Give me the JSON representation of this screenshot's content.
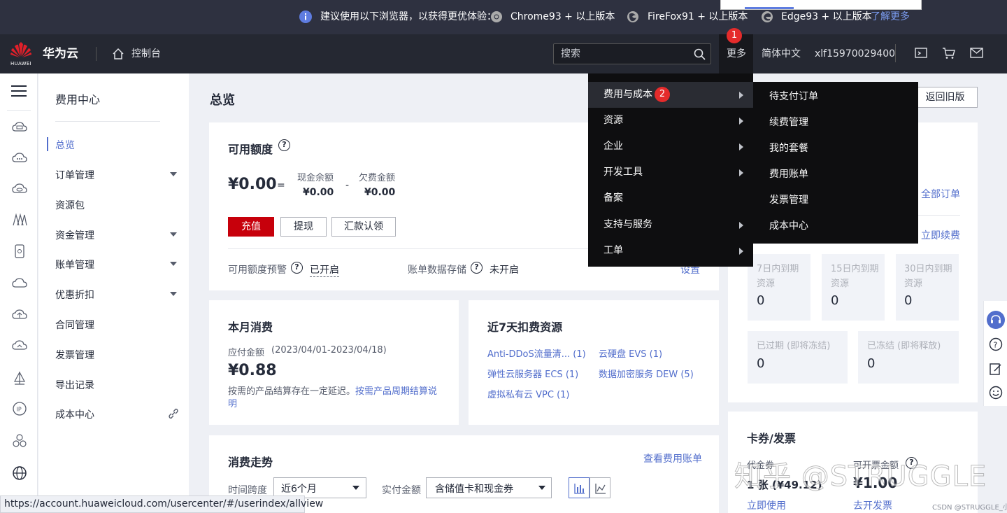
{
  "tip_bar": {
    "message": "建议使用以下浏览器，以获得更优体验：",
    "chrome": "Chrome93 + 以上版本",
    "firefox": "FireFox91 + 以上版本",
    "edge": "Edge93 + 以上版本",
    "learn_more": "了解更多"
  },
  "header": {
    "brand_small": "HUAWEI",
    "brand": "华为云",
    "console": "控制台",
    "search_placeholder": "搜索",
    "more": "更多",
    "more_badge": "1",
    "language": "简体中文",
    "username": "xlf15970029400"
  },
  "sidebar": {
    "title": "费用中心",
    "items": [
      {
        "label": "总览",
        "active": true
      },
      {
        "label": "订单管理",
        "expandable": true
      },
      {
        "label": "资源包"
      },
      {
        "label": "资金管理",
        "expandable": true
      },
      {
        "label": "账单管理",
        "expandable": true
      },
      {
        "label": "优惠折扣",
        "expandable": true
      },
      {
        "label": "合同管理"
      },
      {
        "label": "发票管理"
      },
      {
        "label": "导出记录"
      },
      {
        "label": "成本中心",
        "external": true
      }
    ]
  },
  "page": {
    "title": "总览",
    "back_old": "返回旧版"
  },
  "quota": {
    "title": "可用额度",
    "amount": "¥0.00",
    "equals": "=",
    "cash_label": "现金余额",
    "cash_value": "¥0.00",
    "minus": "-",
    "debt_label": "欠费金额",
    "debt_value": "¥0.00",
    "btn_recharge": "充值",
    "btn_withdraw": "提现",
    "btn_remit": "汇款认领",
    "alert_label": "可用额度预警",
    "alert_status": "已开启",
    "storage_label": "账单数据存储",
    "storage_status": "未开启",
    "settings": "设置"
  },
  "month": {
    "title": "本月消费",
    "due_label": "应付金额",
    "period": "(2023/04/01-2023/04/18)",
    "amount": "¥0.88",
    "note": "按需的产品结算存在一定延迟。",
    "note_link": "按需产品周期结算说明"
  },
  "resources": {
    "title": "近7天扣费资源",
    "items": [
      {
        "name": "Anti-DDoS流量清...",
        "count": "(1)"
      },
      {
        "name": "云硬盘 EVS",
        "count": "(1)"
      },
      {
        "name": "弹性云服务器 ECS",
        "count": "(1)"
      },
      {
        "name": "数据加密服务 DEW",
        "count": "(5)"
      },
      {
        "name": "虚拟私有云 VPC",
        "count": "(1)"
      }
    ]
  },
  "trend": {
    "title": "消费走势",
    "view_bill": "查看费用账单",
    "span_label": "时间跨度",
    "span_value": "近6个月",
    "amount_label": "实付金额",
    "amount_value": "含储值卡和现金券"
  },
  "right_panel": {
    "all_orders": "全部订单",
    "renew_now": "立即续费",
    "tiles": [
      {
        "label": "7日内到期资源",
        "value": "0"
      },
      {
        "label": "15日内到期资源",
        "value": "0"
      },
      {
        "label": "30日内到期资源",
        "value": "0"
      },
      {
        "label": "已过期 (即将冻结)",
        "value": "0"
      },
      {
        "label": "已冻结 (即将释放)",
        "value": "0"
      }
    ],
    "coupon_title": "卡券/发票",
    "coupon_label": "代金券",
    "coupon_value": "1 张 (¥49.12)",
    "invoice_label": "可开票金额",
    "invoice_value": "¥1.00",
    "use_now": "立即使用",
    "issue_invoice": "去开发票"
  },
  "more_menu": {
    "items": [
      {
        "label": "费用与成本",
        "badge": "2",
        "submenu": true,
        "active": true
      },
      {
        "label": "资源",
        "submenu": true
      },
      {
        "label": "企业",
        "submenu": true
      },
      {
        "label": "开发工具",
        "submenu": true
      },
      {
        "label": "备案",
        "submenu": false
      },
      {
        "label": "支持与服务",
        "submenu": true
      },
      {
        "label": "工单",
        "submenu": true
      }
    ],
    "submenu": [
      "待支付订单",
      "续费管理",
      "我的套餐",
      "费用账单",
      "发票管理",
      "成本中心"
    ]
  },
  "status_bar_url": "https://account.huaweicloud.com/usercenter/#/userindex/allview",
  "watermark": "知乎 @STRUGGLE",
  "watermark_small": "CSDN @STRUGGLE_小"
}
